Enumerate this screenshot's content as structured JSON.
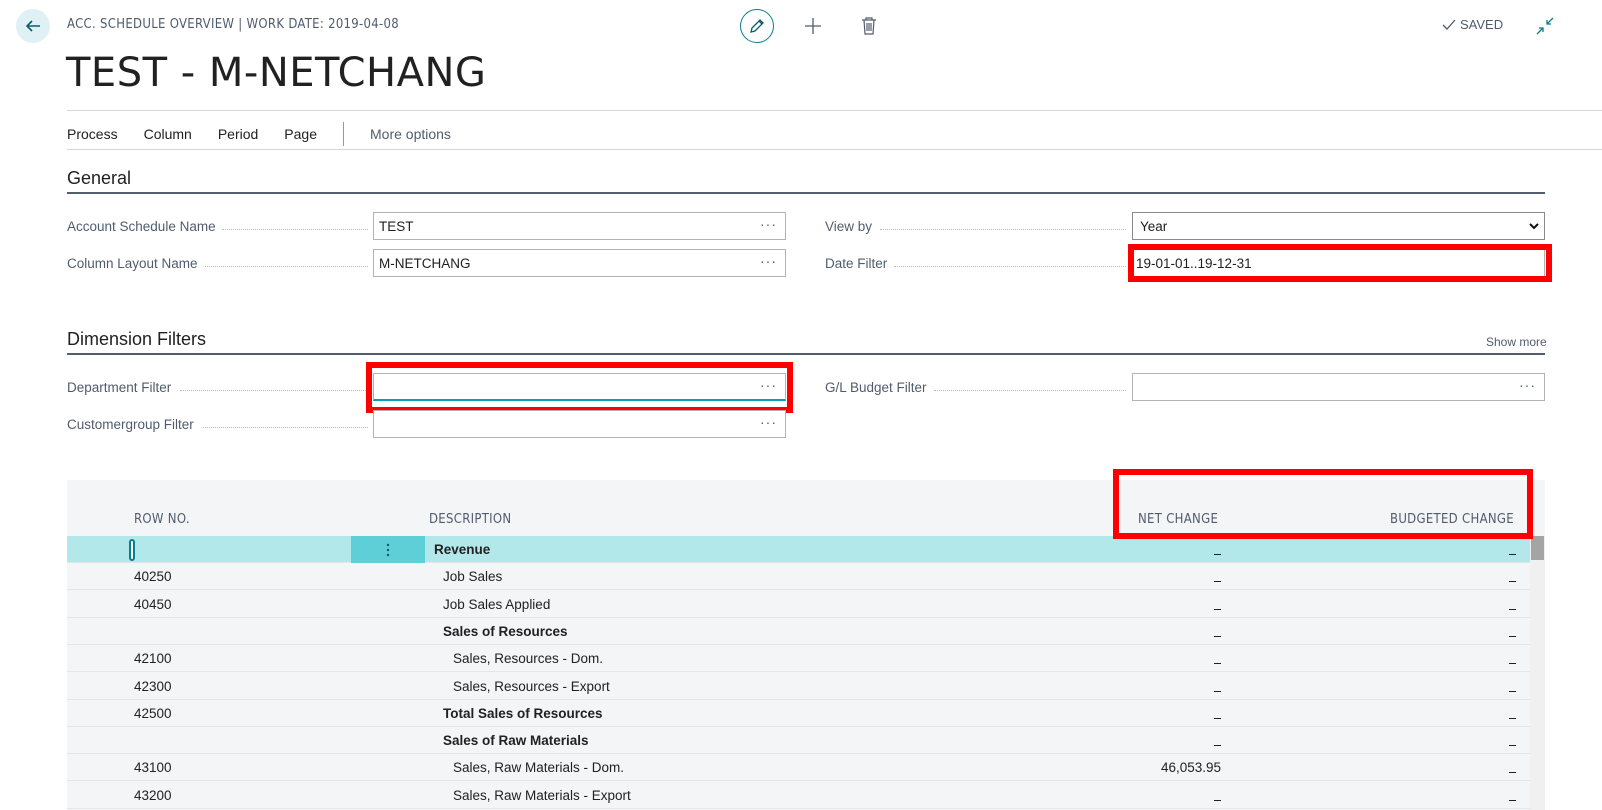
{
  "header": {
    "caption": "ACC. SCHEDULE OVERVIEW | WORK DATE: 2019-04-08",
    "status": "SAVED",
    "title": "TEST - M-NETCHANG"
  },
  "actionbar": {
    "items": [
      "Process",
      "Column",
      "Period",
      "Page"
    ],
    "more": "More options"
  },
  "general": {
    "title": "General",
    "account_schedule_name_label": "Account Schedule Name",
    "account_schedule_name_value": "TEST",
    "column_layout_name_label": "Column Layout Name",
    "column_layout_name_value": "M-NETCHANG",
    "view_by_label": "View by",
    "view_by_value": "Year",
    "date_filter_label": "Date Filter",
    "date_filter_value": "19-01-01..19-12-31"
  },
  "dimensions": {
    "title": "Dimension Filters",
    "show_more": "Show more",
    "department_filter_label": "Department Filter",
    "department_filter_value": "",
    "customergroup_filter_label": "Customergroup Filter",
    "customergroup_filter_value": "",
    "gl_budget_filter_label": "G/L Budget Filter",
    "gl_budget_filter_value": ""
  },
  "grid": {
    "columns": {
      "row_no": "ROW NO.",
      "description": "DESCRIPTION",
      "net_change": "NET CHANGE",
      "budgeted_change": "BUDGETED CHANGE"
    },
    "rows": [
      {
        "row_no": "",
        "description": "Revenue",
        "net": "",
        "budget": "",
        "bold": true,
        "indent": 0
      },
      {
        "row_no": "40250",
        "description": "Job Sales",
        "net": "",
        "budget": "",
        "bold": false,
        "indent": 1
      },
      {
        "row_no": "40450",
        "description": "Job Sales Applied",
        "net": "",
        "budget": "",
        "bold": false,
        "indent": 1
      },
      {
        "row_no": "",
        "description": "Sales of Resources",
        "net": "",
        "budget": "",
        "bold": true,
        "indent": 1
      },
      {
        "row_no": "42100",
        "description": "Sales, Resources - Dom.",
        "net": "",
        "budget": "",
        "bold": false,
        "indent": 2
      },
      {
        "row_no": "42300",
        "description": "Sales, Resources - Export",
        "net": "",
        "budget": "",
        "bold": false,
        "indent": 2
      },
      {
        "row_no": "42500",
        "description": "Total Sales of Resources",
        "net": "",
        "budget": "",
        "bold": true,
        "indent": 1
      },
      {
        "row_no": "",
        "description": "Sales of Raw Materials",
        "net": "",
        "budget": "",
        "bold": true,
        "indent": 1
      },
      {
        "row_no": "43100",
        "description": "Sales, Raw Materials - Dom.",
        "net": "46,053.95",
        "budget": "",
        "bold": false,
        "indent": 2
      },
      {
        "row_no": "43200",
        "description": "Sales, Raw Materials - Export",
        "net": "",
        "budget": "",
        "bold": false,
        "indent": 2
      }
    ]
  }
}
